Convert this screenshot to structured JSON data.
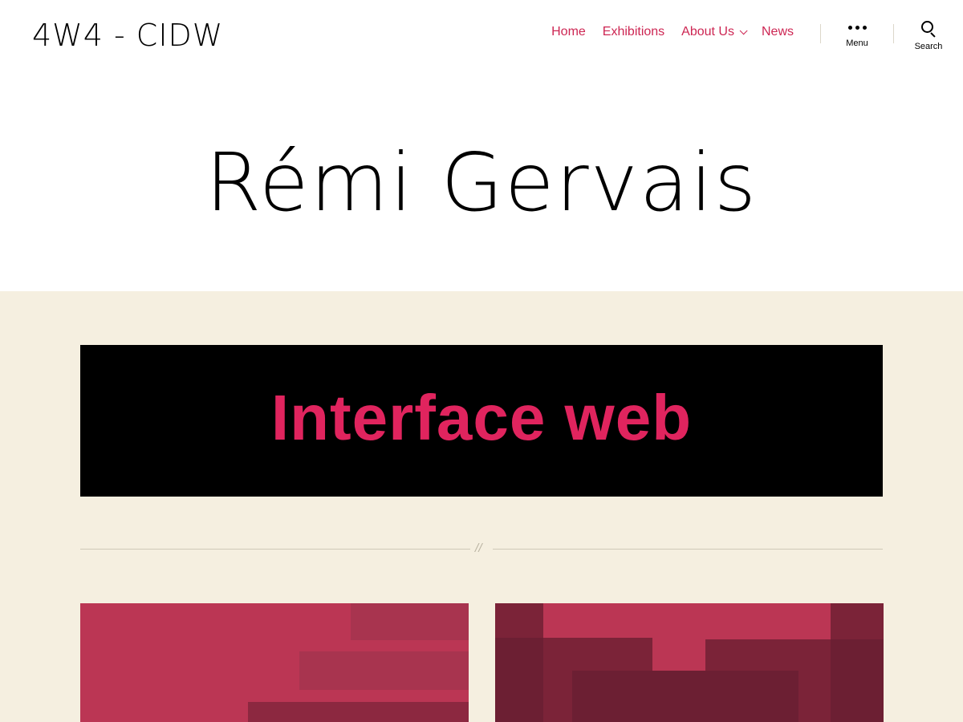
{
  "site": {
    "title": "4W4 - CIDW"
  },
  "nav": {
    "items": [
      {
        "label": "Home"
      },
      {
        "label": "Exhibitions"
      },
      {
        "label": "About Us"
      },
      {
        "label": "News"
      }
    ]
  },
  "toggles": {
    "menu_label": "Menu",
    "search_label": "Search"
  },
  "page": {
    "title": "Rémi Gervais",
    "banner_text": "Interface web",
    "separator": "//"
  },
  "colors": {
    "accent": "#cd2653",
    "content_background": "#f5efe0",
    "banner_background": "#000000",
    "banner_text": "#e0245e"
  }
}
